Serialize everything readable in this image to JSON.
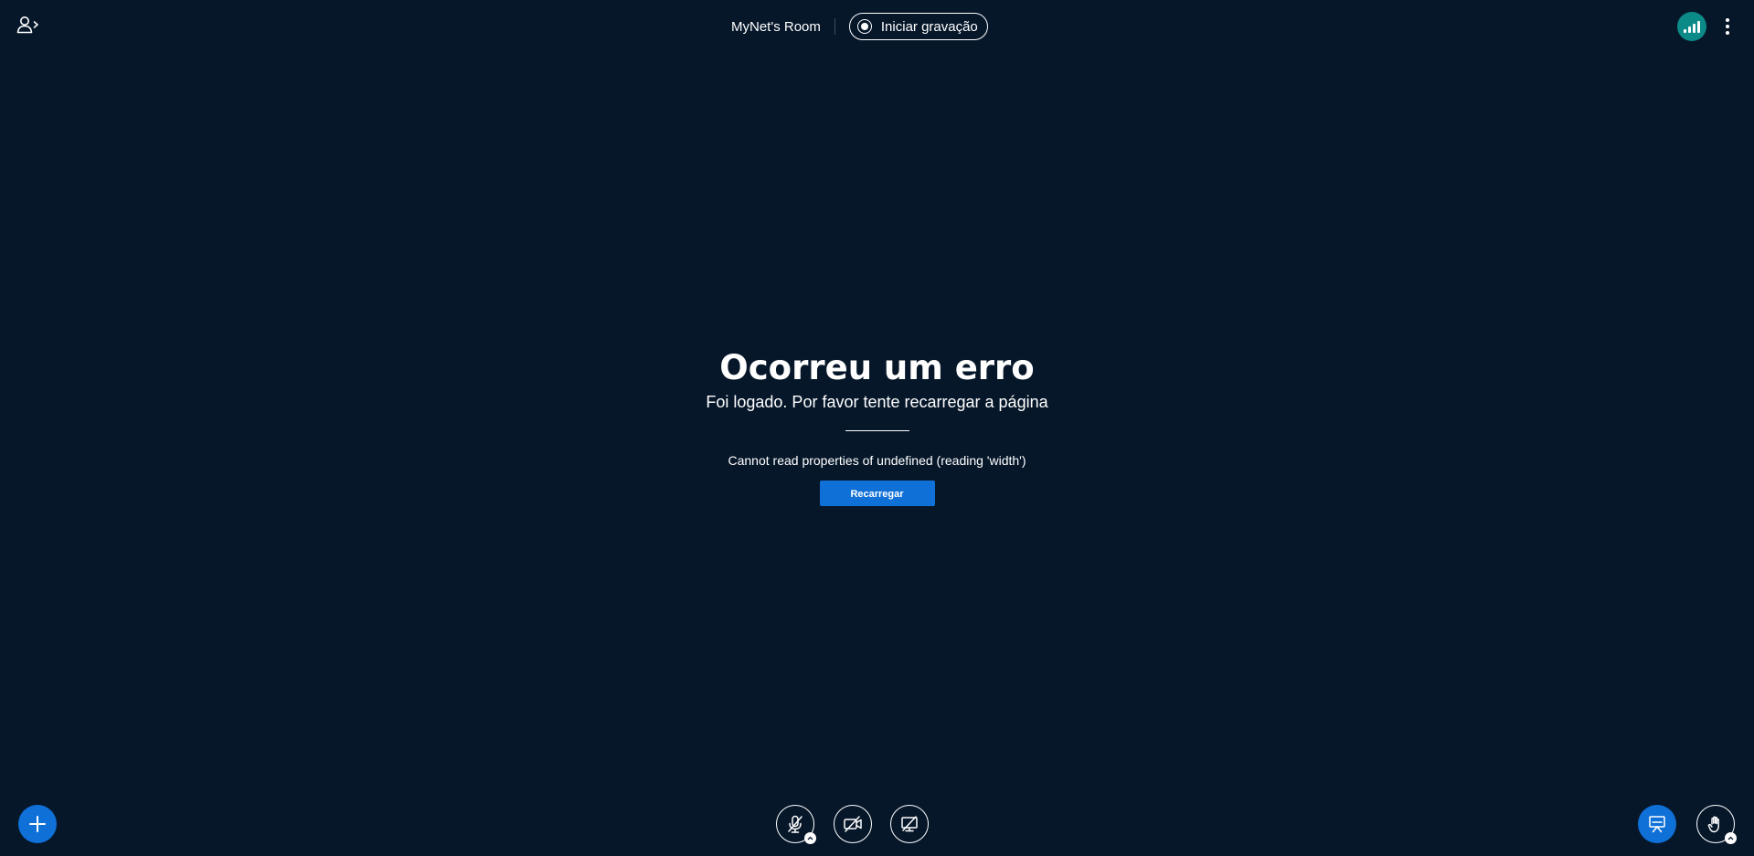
{
  "topbar": {
    "room_title": "MyNet's Room",
    "record_label": "Iniciar gravação",
    "icons": {
      "user_list": "user-list-toggle-icon",
      "record": "record-icon",
      "connection": "connection-status-icon",
      "options": "options-kebab-icon"
    },
    "connection_color": "#0c8a88"
  },
  "error": {
    "title": "Ocorreu um erro",
    "subtitle": "Foi logado. Por favor tente recarregar a página",
    "message": "Cannot read properties of undefined (reading 'width')",
    "reload_label": "Recarregar"
  },
  "bottombar": {
    "actions_icon": "plus-icon",
    "audio_icon": "microphone-muted-icon",
    "video_icon": "camera-off-icon",
    "screenshare_icon": "screenshare-off-icon",
    "presentation_icon": "presentation-icon",
    "raise_hand_icon": "hand-icon"
  },
  "colors": {
    "background": "#06172a",
    "accent": "#0f70d7"
  }
}
